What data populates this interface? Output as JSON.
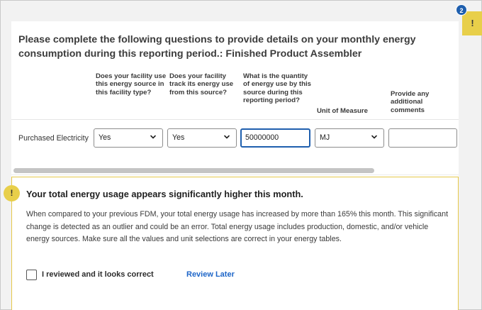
{
  "question": {
    "title": "Please complete the following questions to provide details on your monthly energy consumption during this reporting period.: Finished Product Assembler"
  },
  "table": {
    "columns": [
      "Does your facility use this energy source in this facility type?",
      "Does your facility track its energy use from this source?",
      "What is the quantity of energy use by this source during this reporting period?",
      "Unit of Measure",
      "Provide any additional comments"
    ],
    "rows": [
      {
        "label": "Purchased Electricity",
        "uses_source": "Yes",
        "tracks_use": "Yes",
        "quantity": "50000000",
        "unit": "MJ",
        "comments": ""
      }
    ]
  },
  "warning": {
    "badge": "!",
    "title": "Your total energy usage appears significantly higher this month.",
    "body": "When compared to your previous FDM, your total energy usage has increased by more than 165% this month. This significant change is detected as an outlier and could be an error. Total energy usage includes production, domestic, and/or vehicle energy sources.  Make sure all the values and unit selections are correct in your energy tables.",
    "checkbox_label": "I reviewed and it looks correct",
    "checkbox_checked": false,
    "review_later": "Review Later",
    "accent_color": "#e8cf4a"
  },
  "side_panel": {
    "tab_symbol": "!",
    "count": "2",
    "count_color": "#1f5fae"
  },
  "scroll": {
    "horizontal_position": 0
  },
  "icons": {
    "select_chevron": "chevron-down-icon",
    "warning": "exclamation-icon"
  }
}
